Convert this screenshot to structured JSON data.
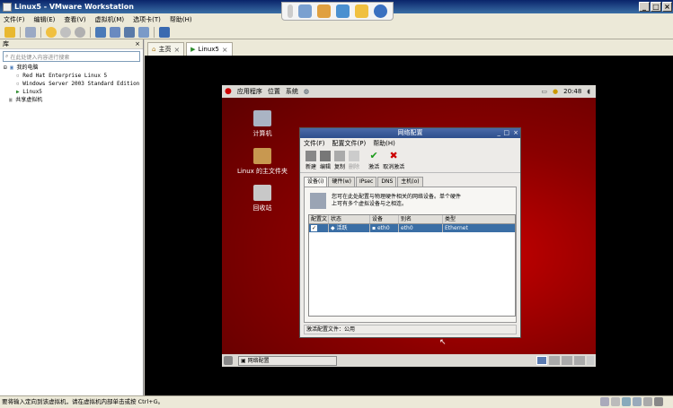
{
  "window": {
    "title": "Linux5 - VMware Workstation"
  },
  "menubar": {
    "items": [
      "文件(F)",
      "编辑(E)",
      "查看(V)",
      "虚拟机(M)",
      "选项卡(T)",
      "帮助(H)"
    ]
  },
  "library": {
    "title": "库",
    "close": "×",
    "search_placeholder": "在此处键入内容进行搜索",
    "tree": [
      "我的电脑",
      "Red Hat Enterprise Linux 5",
      "Windows Server 2003 Standard Edition",
      "Linux5",
      "共享虚拟机"
    ]
  },
  "tabs": [
    {
      "label": "主页"
    },
    {
      "label": "Linux5"
    }
  ],
  "guest": {
    "panel": {
      "apps": "应用程序",
      "places": "位置",
      "system": "系统",
      "clock": "20:48"
    },
    "desktop_icons": [
      "计算机",
      "Linux 的主文件夹",
      "回收站"
    ],
    "taskbar_item": "网络配置"
  },
  "dialog": {
    "title": "网络配置",
    "menu": [
      "文件(F)",
      "配置文件(P)",
      "帮助(H)"
    ],
    "tools": [
      "新建",
      "编辑",
      "复制",
      "删除",
      "激活",
      "取消激活"
    ],
    "tabs": [
      "设备(i)",
      "硬件(w)",
      "IPsec",
      "DNS",
      "主机(o)"
    ],
    "description_line1": "您可在此处配置与物理硬件相关的网络设备。单个硬件",
    "description_line2": "上可有多个虚拟设备与之相连。",
    "table": {
      "headers": [
        "配置文",
        "状态",
        "设备",
        "别名",
        "类型"
      ],
      "rows": [
        {
          "status": "活跃",
          "device": "eth0",
          "alias": "eth0",
          "type": "Ethernet"
        }
      ]
    },
    "status": "激活配置文件：公用"
  },
  "statusbar": {
    "text": "要将输入定向到该虚拟机，请在虚拟机内部单击或按 Ctrl+G。"
  }
}
